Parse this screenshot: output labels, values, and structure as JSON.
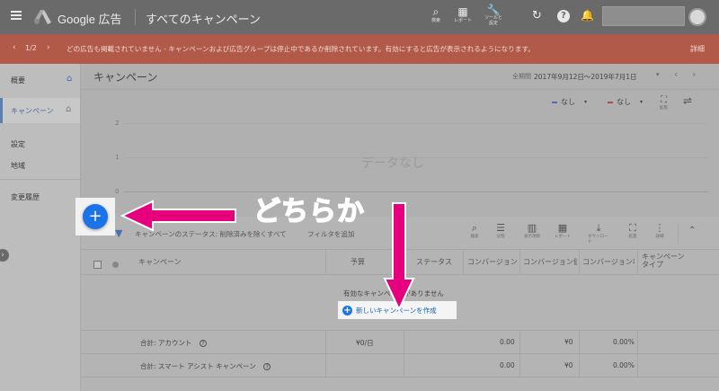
{
  "topbar": {
    "logo_text": "Google 広告",
    "page_title": "すべてのキャンペーン",
    "tools": [
      {
        "label": "検索",
        "icon": "search-icon"
      },
      {
        "label": "レポート",
        "icon": "report-icon"
      },
      {
        "label": "ツールと設定",
        "icon": "wrench-icon"
      }
    ]
  },
  "alert": {
    "counter": "1/2",
    "message": "どの広告も掲載されていません - キャンペーンおよび広告グループは停止中であるか削除されています。有効にすると広告が表示されるようになります。",
    "details_label": "詳細"
  },
  "sidebar": {
    "items": [
      {
        "label": "概要"
      },
      {
        "label": "キャンペーン"
      },
      {
        "label": "設定"
      },
      {
        "label": "地域"
      },
      {
        "label": "変更履歴"
      }
    ]
  },
  "main": {
    "title": "キャンペーン",
    "date_label": "全期間",
    "date_range": "2017年9月12日〜2019年7月1日",
    "metric1": "なし",
    "metric2": "なし",
    "expand_label": "拡張",
    "chart_y_ticks": [
      "2",
      "1",
      "0"
    ],
    "no_data": "データなし",
    "filter_text": "キャンペーンのステータス: 削除済みを除くすべて",
    "add_filter": "フィルタを追加",
    "toolbar": [
      {
        "label": "検索"
      },
      {
        "label": "分割"
      },
      {
        "label": "表示項目"
      },
      {
        "label": "レポート"
      },
      {
        "label": "ダウンロード"
      },
      {
        "label": "拡張"
      },
      {
        "label": "詳細"
      }
    ],
    "columns": [
      "キャンペーン",
      "予算",
      "ステータス",
      "コンバージョン",
      "コンバージョン値",
      "コンバージョン率",
      "キャンペーン タイプ"
    ],
    "empty_msg": "有効なキャンペーンがありません",
    "create_link": "新しいキャンペーンを作成",
    "totals": [
      {
        "label": "合計: アカウント",
        "budget": "¥0/日",
        "conv": "0.00",
        "value": "¥0",
        "rate": "0.00%"
      },
      {
        "label": "合計: スマート アシスト キャンペーン",
        "budget": "",
        "conv": "0.00",
        "value": "¥0",
        "rate": "0.00%"
      }
    ]
  },
  "annotation": {
    "text": "どちらか",
    "plus": "+"
  },
  "colors": {
    "accent": "#1a73e8",
    "annotation": "#e6007e",
    "alert": "#b25a4a"
  }
}
